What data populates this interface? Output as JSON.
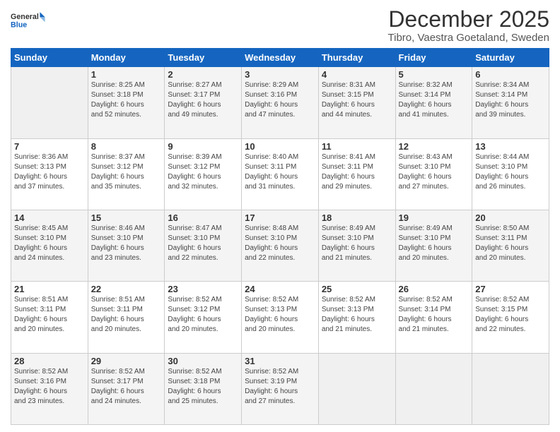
{
  "logo": {
    "line1": "General",
    "line2": "Blue"
  },
  "title": "December 2025",
  "location": "Tibro, Vaestra Goetaland, Sweden",
  "days_of_week": [
    "Sunday",
    "Monday",
    "Tuesday",
    "Wednesday",
    "Thursday",
    "Friday",
    "Saturday"
  ],
  "weeks": [
    [
      {
        "day": "",
        "info": ""
      },
      {
        "day": "1",
        "info": "Sunrise: 8:25 AM\nSunset: 3:18 PM\nDaylight: 6 hours\nand 52 minutes."
      },
      {
        "day": "2",
        "info": "Sunrise: 8:27 AM\nSunset: 3:17 PM\nDaylight: 6 hours\nand 49 minutes."
      },
      {
        "day": "3",
        "info": "Sunrise: 8:29 AM\nSunset: 3:16 PM\nDaylight: 6 hours\nand 47 minutes."
      },
      {
        "day": "4",
        "info": "Sunrise: 8:31 AM\nSunset: 3:15 PM\nDaylight: 6 hours\nand 44 minutes."
      },
      {
        "day": "5",
        "info": "Sunrise: 8:32 AM\nSunset: 3:14 PM\nDaylight: 6 hours\nand 41 minutes."
      },
      {
        "day": "6",
        "info": "Sunrise: 8:34 AM\nSunset: 3:14 PM\nDaylight: 6 hours\nand 39 minutes."
      }
    ],
    [
      {
        "day": "7",
        "info": "Sunrise: 8:36 AM\nSunset: 3:13 PM\nDaylight: 6 hours\nand 37 minutes."
      },
      {
        "day": "8",
        "info": "Sunrise: 8:37 AM\nSunset: 3:12 PM\nDaylight: 6 hours\nand 35 minutes."
      },
      {
        "day": "9",
        "info": "Sunrise: 8:39 AM\nSunset: 3:12 PM\nDaylight: 6 hours\nand 32 minutes."
      },
      {
        "day": "10",
        "info": "Sunrise: 8:40 AM\nSunset: 3:11 PM\nDaylight: 6 hours\nand 31 minutes."
      },
      {
        "day": "11",
        "info": "Sunrise: 8:41 AM\nSunset: 3:11 PM\nDaylight: 6 hours\nand 29 minutes."
      },
      {
        "day": "12",
        "info": "Sunrise: 8:43 AM\nSunset: 3:10 PM\nDaylight: 6 hours\nand 27 minutes."
      },
      {
        "day": "13",
        "info": "Sunrise: 8:44 AM\nSunset: 3:10 PM\nDaylight: 6 hours\nand 26 minutes."
      }
    ],
    [
      {
        "day": "14",
        "info": "Sunrise: 8:45 AM\nSunset: 3:10 PM\nDaylight: 6 hours\nand 24 minutes."
      },
      {
        "day": "15",
        "info": "Sunrise: 8:46 AM\nSunset: 3:10 PM\nDaylight: 6 hours\nand 23 minutes."
      },
      {
        "day": "16",
        "info": "Sunrise: 8:47 AM\nSunset: 3:10 PM\nDaylight: 6 hours\nand 22 minutes."
      },
      {
        "day": "17",
        "info": "Sunrise: 8:48 AM\nSunset: 3:10 PM\nDaylight: 6 hours\nand 22 minutes."
      },
      {
        "day": "18",
        "info": "Sunrise: 8:49 AM\nSunset: 3:10 PM\nDaylight: 6 hours\nand 21 minutes."
      },
      {
        "day": "19",
        "info": "Sunrise: 8:49 AM\nSunset: 3:10 PM\nDaylight: 6 hours\nand 20 minutes."
      },
      {
        "day": "20",
        "info": "Sunrise: 8:50 AM\nSunset: 3:11 PM\nDaylight: 6 hours\nand 20 minutes."
      }
    ],
    [
      {
        "day": "21",
        "info": "Sunrise: 8:51 AM\nSunset: 3:11 PM\nDaylight: 6 hours\nand 20 minutes."
      },
      {
        "day": "22",
        "info": "Sunrise: 8:51 AM\nSunset: 3:11 PM\nDaylight: 6 hours\nand 20 minutes."
      },
      {
        "day": "23",
        "info": "Sunrise: 8:52 AM\nSunset: 3:12 PM\nDaylight: 6 hours\nand 20 minutes."
      },
      {
        "day": "24",
        "info": "Sunrise: 8:52 AM\nSunset: 3:13 PM\nDaylight: 6 hours\nand 20 minutes."
      },
      {
        "day": "25",
        "info": "Sunrise: 8:52 AM\nSunset: 3:13 PM\nDaylight: 6 hours\nand 21 minutes."
      },
      {
        "day": "26",
        "info": "Sunrise: 8:52 AM\nSunset: 3:14 PM\nDaylight: 6 hours\nand 21 minutes."
      },
      {
        "day": "27",
        "info": "Sunrise: 8:52 AM\nSunset: 3:15 PM\nDaylight: 6 hours\nand 22 minutes."
      }
    ],
    [
      {
        "day": "28",
        "info": "Sunrise: 8:52 AM\nSunset: 3:16 PM\nDaylight: 6 hours\nand 23 minutes."
      },
      {
        "day": "29",
        "info": "Sunrise: 8:52 AM\nSunset: 3:17 PM\nDaylight: 6 hours\nand 24 minutes."
      },
      {
        "day": "30",
        "info": "Sunrise: 8:52 AM\nSunset: 3:18 PM\nDaylight: 6 hours\nand 25 minutes."
      },
      {
        "day": "31",
        "info": "Sunrise: 8:52 AM\nSunset: 3:19 PM\nDaylight: 6 hours\nand 27 minutes."
      },
      {
        "day": "",
        "info": ""
      },
      {
        "day": "",
        "info": ""
      },
      {
        "day": "",
        "info": ""
      }
    ]
  ]
}
